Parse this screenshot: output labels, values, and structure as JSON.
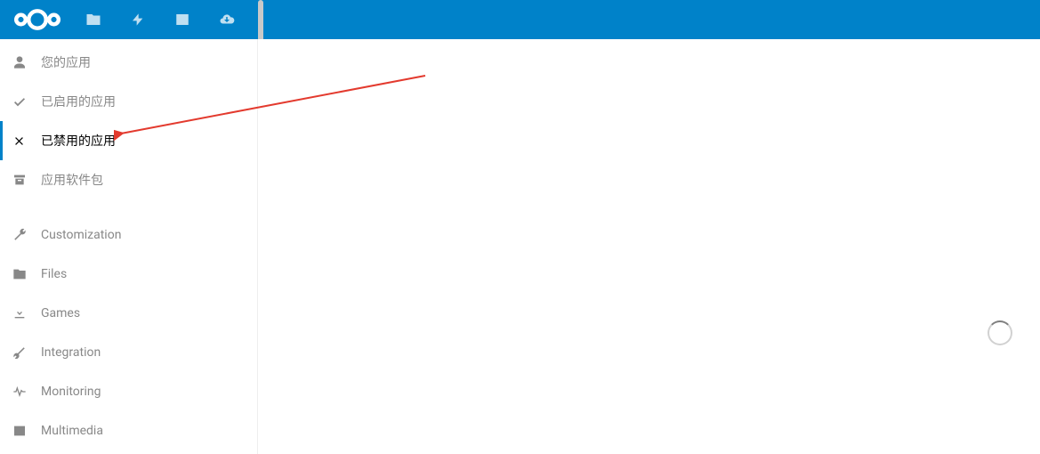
{
  "topbar": {
    "icons": [
      "files",
      "activity",
      "gallery",
      "download"
    ]
  },
  "sidebar": {
    "section1": [
      {
        "id": "your-apps",
        "label": "您的应用",
        "icon": "user",
        "active": false
      },
      {
        "id": "enabled-apps",
        "label": "已启用的应用",
        "icon": "check",
        "active": false
      },
      {
        "id": "disabled-apps",
        "label": "已禁用的应用",
        "icon": "close",
        "active": true
      },
      {
        "id": "app-bundles",
        "label": "应用软件包",
        "icon": "archive",
        "active": false
      }
    ],
    "section2": [
      {
        "id": "customization",
        "label": "Customization",
        "icon": "wrench"
      },
      {
        "id": "files",
        "label": "Files",
        "icon": "folder"
      },
      {
        "id": "games",
        "label": "Games",
        "icon": "download-tray"
      },
      {
        "id": "integration",
        "label": "Integration",
        "icon": "wrench2"
      },
      {
        "id": "monitoring",
        "label": "Monitoring",
        "icon": "pulse"
      },
      {
        "id": "multimedia",
        "label": "Multimedia",
        "icon": "image"
      }
    ]
  },
  "colors": {
    "brand": "#0082c9",
    "arrow": "#e33a2e"
  }
}
